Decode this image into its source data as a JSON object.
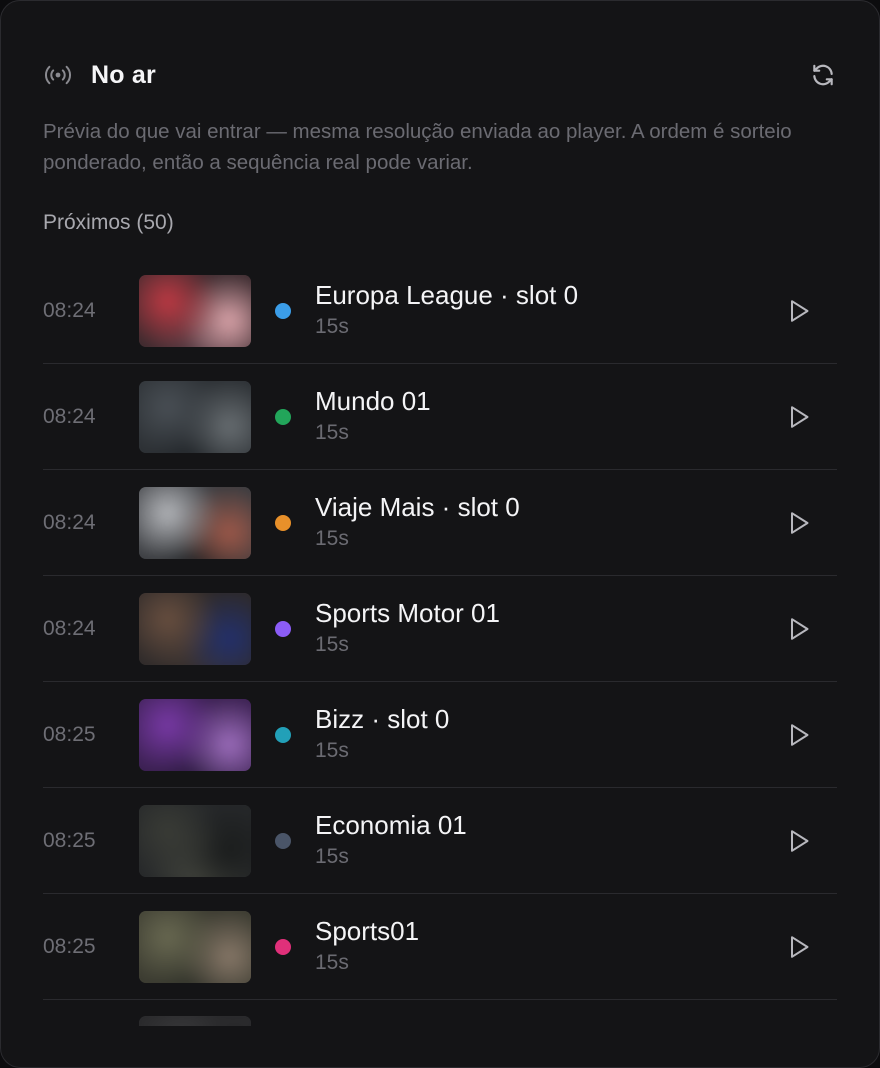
{
  "header": {
    "title": "No ar",
    "broadcast_icon": "broadcast-icon",
    "refresh_icon": "refresh-icon"
  },
  "description": "Prévia do que vai entrar — mesma resolução enviada ao player. A ordem é sorteio ponderado, então a sequência real pode variar.",
  "section": {
    "label": "Próximos (50)"
  },
  "items": [
    {
      "time": "08:24",
      "name": "Europa League · slot 0",
      "duration": "15s",
      "dot_color": "#3b9de8",
      "thumb": {
        "bg": "#3a2a2e",
        "c1": "#c23a44",
        "c2": "#e0a8ae",
        "c3": "#5a4048"
      }
    },
    {
      "time": "08:24",
      "name": "Mundo 01",
      "duration": "15s",
      "dot_color": "#22a55a",
      "thumb": {
        "bg": "#2c3034",
        "c1": "#4a5056",
        "c2": "#6a7074",
        "c3": "#1e2226"
      }
    },
    {
      "time": "08:24",
      "name": "Viaje Mais · slot 0",
      "duration": "15s",
      "dot_color": "#e8902a",
      "thumb": {
        "bg": "#3a3c40",
        "c1": "#b8babe",
        "c2": "#a25a4a",
        "c3": "#1c1e20"
      }
    },
    {
      "time": "08:24",
      "name": "Sports Motor 01",
      "duration": "15s",
      "dot_color": "#8b5cf6",
      "thumb": {
        "bg": "#2e2a2a",
        "c1": "#6a5040",
        "c2": "#22306e",
        "c3": "#3a3230"
      }
    },
    {
      "time": "08:25",
      "name": "Bizz · slot 0",
      "duration": "15s",
      "dot_color": "#22a0b8",
      "thumb": {
        "bg": "#3a2050",
        "c1": "#7a3aa8",
        "c2": "#a070c0",
        "c3": "#2a1a3e"
      }
    },
    {
      "time": "08:25",
      "name": "Economia 01",
      "duration": "15s",
      "dot_color": "#4a5568",
      "thumb": {
        "bg": "#26282a",
        "c1": "#3a3c36",
        "c2": "#1a1c1c",
        "c3": "#44463e"
      }
    },
    {
      "time": "08:25",
      "name": "Sports01",
      "duration": "15s",
      "dot_color": "#e0307a",
      "thumb": {
        "bg": "#3a3a30",
        "c1": "#6a6a52",
        "c2": "#8a7a6a",
        "c3": "#2e3028"
      }
    }
  ],
  "partial_item": {
    "thumb": {
      "bg": "#2a2a2c",
      "c1": "#3a3a3c",
      "c2": "#222224",
      "c3": "#303032"
    }
  },
  "colors": {
    "panel_bg": "#141416",
    "divider": "#2a2a2e",
    "muted_text": "#6b6b72",
    "primary_text": "#f4f4f6"
  }
}
